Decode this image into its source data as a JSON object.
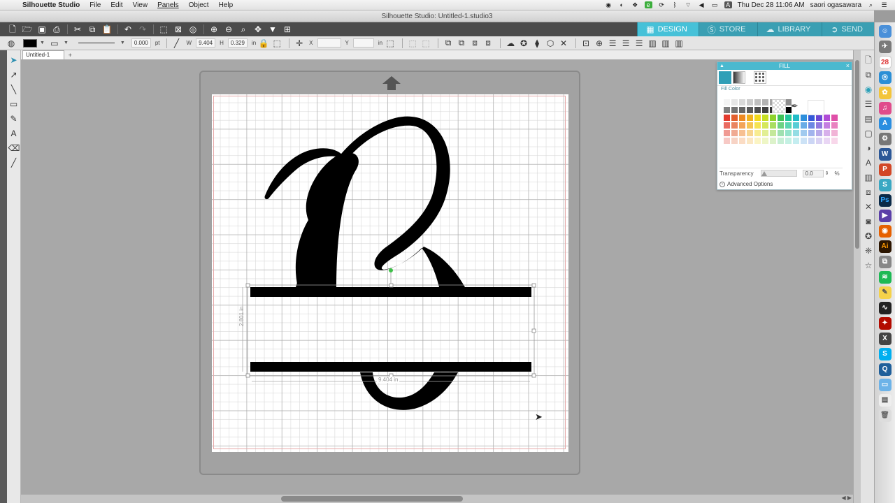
{
  "menubar": {
    "app_name": "Silhouette Studio",
    "items": [
      "File",
      "Edit",
      "View",
      "Panels",
      "Object",
      "Help"
    ],
    "clock": "Thu Dec 28  11:06 AM",
    "user": "saori ogasawara"
  },
  "window": {
    "title": "Silhouette Studio: Untitled-1.studio3"
  },
  "nav_tabs": [
    {
      "label": "DESIGN",
      "icon": "grid-icon"
    },
    {
      "label": "STORE",
      "icon": "store-icon"
    },
    {
      "label": "LIBRARY",
      "icon": "cloud-icon"
    },
    {
      "label": "SEND",
      "icon": "send-icon"
    }
  ],
  "toolbar2": {
    "line_width": "0.000",
    "line_unit": "pt",
    "w_label": "W",
    "w_value": "9.404",
    "h_label": "H",
    "h_value": "0.329",
    "h_unit": "in",
    "x_label": "X",
    "y_label": "Y",
    "y_unit": "in"
  },
  "document": {
    "tab": "Untitled-1",
    "add_tab": "+"
  },
  "dimensions": {
    "height_label": "2.801 in",
    "width_label": "9.404 in"
  },
  "fill_panel": {
    "title": "FILL",
    "fill_color_label": "Fill Color",
    "transparency_label": "Transparency",
    "transparency_value": "0.0",
    "transparency_unit": "%",
    "advanced_options": "Advanced Options"
  },
  "colors": {
    "accent": "#46c1d8",
    "selection_fill": "#000000",
    "palette": [
      [
        "#f4f4f4",
        "#e6e6e6",
        "#d9d9d9",
        "#cccccc",
        "#bfbfbf",
        "#b3b3b3",
        "#a6a6a6",
        "#999999",
        "#8c8c8c"
      ],
      [
        "#808080",
        "#737373",
        "#666666",
        "#595959",
        "#4d4d4d",
        "#404040",
        "#333333",
        "#1a1a1a",
        "#000000"
      ],
      [
        "#e33b2e",
        "#e35f2e",
        "#ee8a22",
        "#f2b21d",
        "#f2d91d",
        "#c6df22",
        "#8ed22b",
        "#3fc35a",
        "#22c79a",
        "#21bcc7",
        "#2d8fdc",
        "#3459d8",
        "#6b46d4",
        "#b04bd6",
        "#e04fa8"
      ],
      [
        "#ea6a60",
        "#ea8460",
        "#f3a458",
        "#f5c453",
        "#f5e353",
        "#d5e85a",
        "#a9de62",
        "#6dd284",
        "#5ad5b1",
        "#58cdd5",
        "#6aace6",
        "#6c87e3",
        "#9179df",
        "#c47ee1",
        "#e983c0"
      ],
      [
        "#f09a93",
        "#f0aa93",
        "#f7c092",
        "#f8d590",
        "#f8ec90",
        "#e2ef94",
        "#c4e89a",
        "#9fe0b0",
        "#95e4cb",
        "#94dde4",
        "#a1caef",
        "#a2b4ed",
        "#b8aaea",
        "#d7b0eb",
        "#f1b3d6"
      ],
      [
        "#f7c9c5",
        "#f7d3c5",
        "#fbdcc4",
        "#fbe7c3",
        "#fbf4c3",
        "#eef6c6",
        "#dcf2ca",
        "#c7eed5",
        "#c4f0e3",
        "#c4edf0",
        "#cce2f6",
        "#ccd6f5",
        "#d9d2f3",
        "#e9d6f4",
        "#f8d7ea"
      ]
    ]
  }
}
